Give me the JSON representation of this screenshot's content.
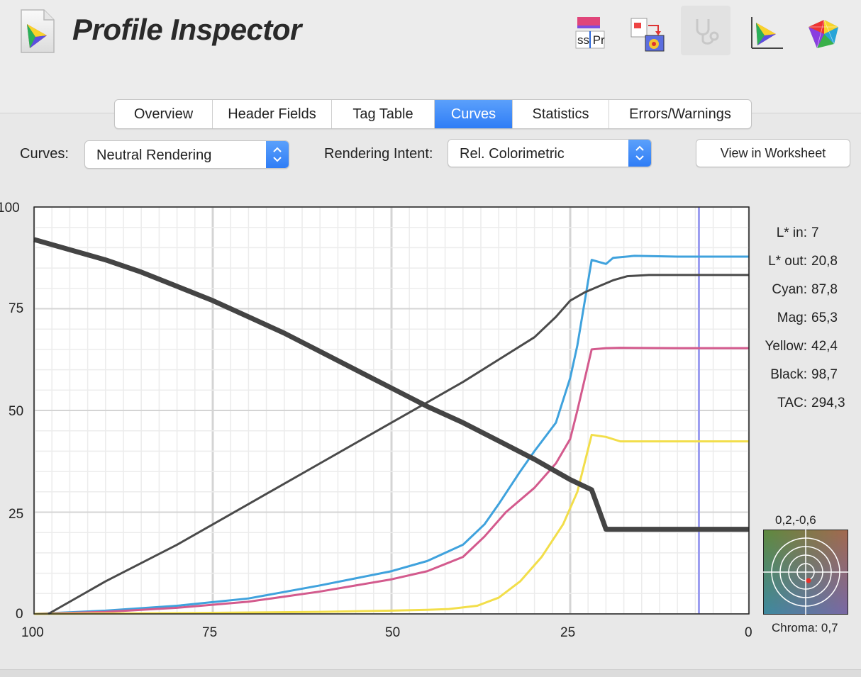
{
  "app": {
    "title": "Profile Inspector"
  },
  "toolbar": {
    "icons": [
      "profile-edit-icon",
      "convert-profile-icon",
      "stethoscope-icon",
      "gamut-plot-icon",
      "color-space-3d-icon"
    ],
    "compare_icon_text": "ss Pr"
  },
  "tabs": [
    {
      "label": "Overview",
      "selected": false
    },
    {
      "label": "Header Fields",
      "selected": false
    },
    {
      "label": "Tag Table",
      "selected": false
    },
    {
      "label": "Curves",
      "selected": true
    },
    {
      "label": "Statistics",
      "selected": false
    },
    {
      "label": "Errors/Warnings",
      "selected": false
    }
  ],
  "controls": {
    "curves_label": "Curves:",
    "curves_value": "Neutral Rendering",
    "intent_label": "Rendering Intent:",
    "intent_value": "Rel. Colorimetric",
    "worksheet_button": "View in Worksheet"
  },
  "readouts": [
    {
      "key": "L* in:",
      "value": "7"
    },
    {
      "key": "L* out:",
      "value": "20,8"
    },
    {
      "key": "Cyan:",
      "value": "87,8"
    },
    {
      "key": "Mag:",
      "value": "65,3"
    },
    {
      "key": "Yellow:",
      "value": "42,4"
    },
    {
      "key": "Black:",
      "value": "98,7"
    },
    {
      "key": "TAC:",
      "value": "294,3"
    }
  ],
  "chroma": {
    "coords": "0,2,-0,6",
    "label": "Chroma:",
    "value": "0,7",
    "a": 0.2,
    "b": -0.6
  },
  "colors": {
    "accent": "#2f7df6",
    "cyan": "#3fa2dd",
    "magenta": "#d35a8d",
    "yellow": "#f2de4a",
    "black": "#4a4a4a",
    "lout": "#444444",
    "cursor": "#9a9cf0"
  },
  "chart_data": {
    "type": "line",
    "x_ticks": [
      "100",
      "75",
      "50",
      "25",
      "0"
    ],
    "y_ticks": [
      "100",
      "75",
      "50",
      "25",
      "0"
    ],
    "xlim": [
      100,
      0
    ],
    "ylim": [
      0,
      100
    ],
    "cursor_x": 7,
    "series": [
      {
        "key": "cyan",
        "points": [
          [
            100,
            0
          ],
          [
            90,
            0.8
          ],
          [
            80,
            2
          ],
          [
            70,
            3.8
          ],
          [
            60,
            7
          ],
          [
            50,
            10.5
          ],
          [
            45,
            13
          ],
          [
            40,
            17
          ],
          [
            37,
            22
          ],
          [
            35,
            27
          ],
          [
            32,
            35
          ],
          [
            30,
            40
          ],
          [
            27,
            47
          ],
          [
            25,
            58
          ],
          [
            24,
            66
          ],
          [
            22,
            87
          ],
          [
            20,
            86
          ],
          [
            19,
            87.5
          ],
          [
            16,
            88
          ],
          [
            10,
            87.8
          ],
          [
            0,
            87.8
          ]
        ]
      },
      {
        "key": "magenta",
        "points": [
          [
            100,
            0
          ],
          [
            90,
            0.5
          ],
          [
            80,
            1.5
          ],
          [
            70,
            3
          ],
          [
            60,
            5.5
          ],
          [
            50,
            8.5
          ],
          [
            45,
            10.5
          ],
          [
            40,
            14
          ],
          [
            37,
            19
          ],
          [
            34,
            25
          ],
          [
            30,
            31
          ],
          [
            27,
            37
          ],
          [
            25,
            43
          ],
          [
            24,
            50
          ],
          [
            22,
            65
          ],
          [
            20,
            65.3
          ],
          [
            18,
            65.4
          ],
          [
            10,
            65.3
          ],
          [
            0,
            65.3
          ]
        ]
      },
      {
        "key": "yellow",
        "points": [
          [
            100,
            0
          ],
          [
            80,
            0.2
          ],
          [
            60,
            0.5
          ],
          [
            50,
            0.8
          ],
          [
            45,
            1
          ],
          [
            42,
            1.2
          ],
          [
            38,
            2
          ],
          [
            35,
            4
          ],
          [
            32,
            8
          ],
          [
            29,
            14
          ],
          [
            26,
            22
          ],
          [
            24,
            30
          ],
          [
            22,
            44
          ],
          [
            20,
            43.5
          ],
          [
            18,
            42.4
          ],
          [
            10,
            42.4
          ],
          [
            0,
            42.4
          ]
        ]
      },
      {
        "key": "black",
        "points": [
          [
            98,
            0
          ],
          [
            90,
            8
          ],
          [
            80,
            17
          ],
          [
            70,
            27
          ],
          [
            60,
            37
          ],
          [
            50,
            47
          ],
          [
            45,
            52
          ],
          [
            40,
            57
          ],
          [
            35,
            62.5
          ],
          [
            30,
            68
          ],
          [
            27,
            73
          ],
          [
            25,
            77
          ],
          [
            23,
            79
          ],
          [
            21,
            80.5
          ],
          [
            19,
            82
          ],
          [
            17,
            83
          ],
          [
            14,
            83.3
          ],
          [
            10,
            83.3
          ],
          [
            0,
            83.3
          ]
        ]
      },
      {
        "key": "lout",
        "points": [
          [
            100,
            92
          ],
          [
            95,
            89.5
          ],
          [
            90,
            87
          ],
          [
            85,
            84
          ],
          [
            80,
            80.5
          ],
          [
            75,
            77
          ],
          [
            70,
            73
          ],
          [
            65,
            69
          ],
          [
            60,
            64.5
          ],
          [
            55,
            60
          ],
          [
            50,
            55.5
          ],
          [
            45,
            51
          ],
          [
            40,
            47
          ],
          [
            35,
            42.5
          ],
          [
            30,
            38
          ],
          [
            25,
            33
          ],
          [
            22,
            30.5
          ],
          [
            20,
            20.8
          ],
          [
            10,
            20.8
          ],
          [
            0,
            20.8
          ]
        ]
      }
    ]
  }
}
